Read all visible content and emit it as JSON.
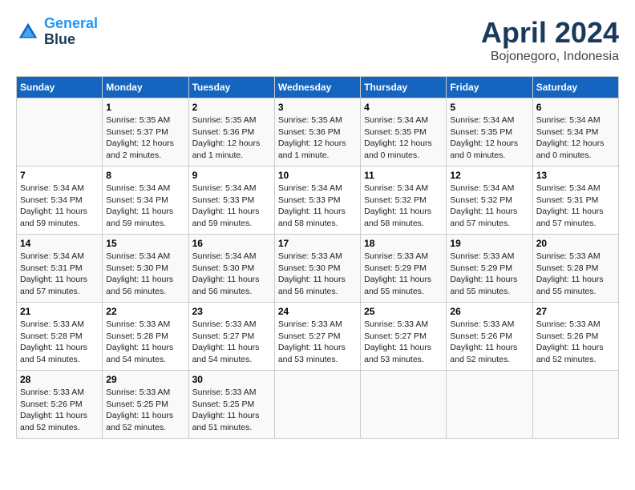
{
  "header": {
    "logo_line1": "General",
    "logo_line2": "Blue",
    "month": "April 2024",
    "location": "Bojonegoro, Indonesia"
  },
  "columns": [
    "Sunday",
    "Monday",
    "Tuesday",
    "Wednesday",
    "Thursday",
    "Friday",
    "Saturday"
  ],
  "weeks": [
    [
      {
        "day": "",
        "info": ""
      },
      {
        "day": "1",
        "info": "Sunrise: 5:35 AM\nSunset: 5:37 PM\nDaylight: 12 hours\nand 2 minutes."
      },
      {
        "day": "2",
        "info": "Sunrise: 5:35 AM\nSunset: 5:36 PM\nDaylight: 12 hours\nand 1 minute."
      },
      {
        "day": "3",
        "info": "Sunrise: 5:35 AM\nSunset: 5:36 PM\nDaylight: 12 hours\nand 1 minute."
      },
      {
        "day": "4",
        "info": "Sunrise: 5:34 AM\nSunset: 5:35 PM\nDaylight: 12 hours\nand 0 minutes."
      },
      {
        "day": "5",
        "info": "Sunrise: 5:34 AM\nSunset: 5:35 PM\nDaylight: 12 hours\nand 0 minutes."
      },
      {
        "day": "6",
        "info": "Sunrise: 5:34 AM\nSunset: 5:34 PM\nDaylight: 12 hours\nand 0 minutes."
      }
    ],
    [
      {
        "day": "7",
        "info": "Sunrise: 5:34 AM\nSunset: 5:34 PM\nDaylight: 11 hours\nand 59 minutes."
      },
      {
        "day": "8",
        "info": "Sunrise: 5:34 AM\nSunset: 5:34 PM\nDaylight: 11 hours\nand 59 minutes."
      },
      {
        "day": "9",
        "info": "Sunrise: 5:34 AM\nSunset: 5:33 PM\nDaylight: 11 hours\nand 59 minutes."
      },
      {
        "day": "10",
        "info": "Sunrise: 5:34 AM\nSunset: 5:33 PM\nDaylight: 11 hours\nand 58 minutes."
      },
      {
        "day": "11",
        "info": "Sunrise: 5:34 AM\nSunset: 5:32 PM\nDaylight: 11 hours\nand 58 minutes."
      },
      {
        "day": "12",
        "info": "Sunrise: 5:34 AM\nSunset: 5:32 PM\nDaylight: 11 hours\nand 57 minutes."
      },
      {
        "day": "13",
        "info": "Sunrise: 5:34 AM\nSunset: 5:31 PM\nDaylight: 11 hours\nand 57 minutes."
      }
    ],
    [
      {
        "day": "14",
        "info": "Sunrise: 5:34 AM\nSunset: 5:31 PM\nDaylight: 11 hours\nand 57 minutes."
      },
      {
        "day": "15",
        "info": "Sunrise: 5:34 AM\nSunset: 5:30 PM\nDaylight: 11 hours\nand 56 minutes."
      },
      {
        "day": "16",
        "info": "Sunrise: 5:34 AM\nSunset: 5:30 PM\nDaylight: 11 hours\nand 56 minutes."
      },
      {
        "day": "17",
        "info": "Sunrise: 5:33 AM\nSunset: 5:30 PM\nDaylight: 11 hours\nand 56 minutes."
      },
      {
        "day": "18",
        "info": "Sunrise: 5:33 AM\nSunset: 5:29 PM\nDaylight: 11 hours\nand 55 minutes."
      },
      {
        "day": "19",
        "info": "Sunrise: 5:33 AM\nSunset: 5:29 PM\nDaylight: 11 hours\nand 55 minutes."
      },
      {
        "day": "20",
        "info": "Sunrise: 5:33 AM\nSunset: 5:28 PM\nDaylight: 11 hours\nand 55 minutes."
      }
    ],
    [
      {
        "day": "21",
        "info": "Sunrise: 5:33 AM\nSunset: 5:28 PM\nDaylight: 11 hours\nand 54 minutes."
      },
      {
        "day": "22",
        "info": "Sunrise: 5:33 AM\nSunset: 5:28 PM\nDaylight: 11 hours\nand 54 minutes."
      },
      {
        "day": "23",
        "info": "Sunrise: 5:33 AM\nSunset: 5:27 PM\nDaylight: 11 hours\nand 54 minutes."
      },
      {
        "day": "24",
        "info": "Sunrise: 5:33 AM\nSunset: 5:27 PM\nDaylight: 11 hours\nand 53 minutes."
      },
      {
        "day": "25",
        "info": "Sunrise: 5:33 AM\nSunset: 5:27 PM\nDaylight: 11 hours\nand 53 minutes."
      },
      {
        "day": "26",
        "info": "Sunrise: 5:33 AM\nSunset: 5:26 PM\nDaylight: 11 hours\nand 52 minutes."
      },
      {
        "day": "27",
        "info": "Sunrise: 5:33 AM\nSunset: 5:26 PM\nDaylight: 11 hours\nand 52 minutes."
      }
    ],
    [
      {
        "day": "28",
        "info": "Sunrise: 5:33 AM\nSunset: 5:26 PM\nDaylight: 11 hours\nand 52 minutes."
      },
      {
        "day": "29",
        "info": "Sunrise: 5:33 AM\nSunset: 5:25 PM\nDaylight: 11 hours\nand 52 minutes."
      },
      {
        "day": "30",
        "info": "Sunrise: 5:33 AM\nSunset: 5:25 PM\nDaylight: 11 hours\nand 51 minutes."
      },
      {
        "day": "",
        "info": ""
      },
      {
        "day": "",
        "info": ""
      },
      {
        "day": "",
        "info": ""
      },
      {
        "day": "",
        "info": ""
      }
    ]
  ]
}
